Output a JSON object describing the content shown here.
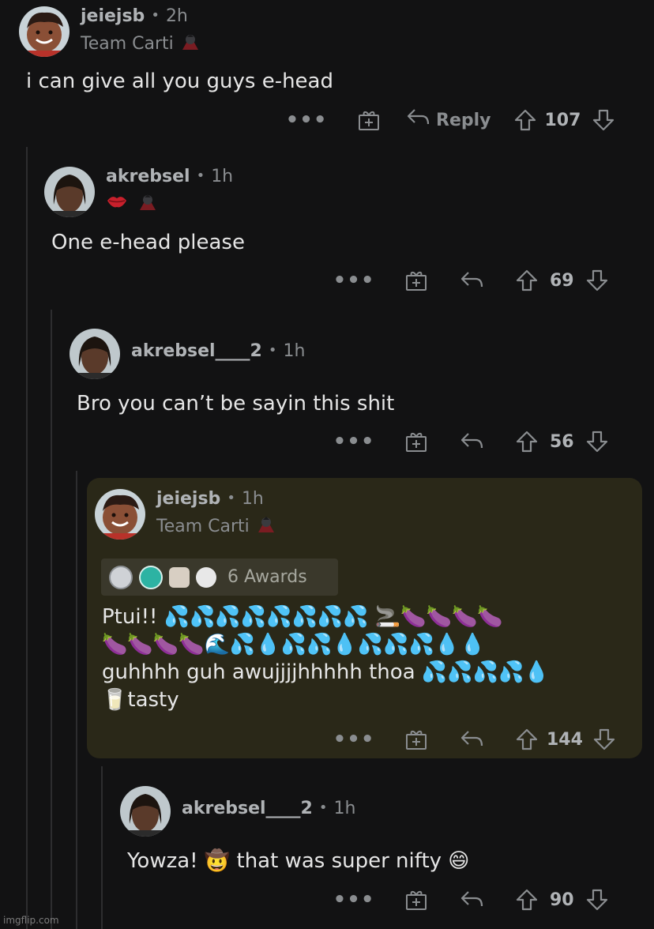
{
  "comments": [
    {
      "username": "jeiejsb",
      "sep": "•",
      "age": "2h",
      "flair": "Team Carti",
      "body": "i can give all you guys e-head",
      "more": "•••",
      "reply": "Reply",
      "score": "107"
    },
    {
      "username": "akrebsel",
      "sep": "•",
      "age": "1h",
      "body": "One e-head please",
      "more": "•••",
      "score": "69"
    },
    {
      "username": "akrebsel____2",
      "sep": "•",
      "age": "1h",
      "body": "Bro you can’t be sayin this shit",
      "more": "•••",
      "score": "56"
    },
    {
      "username": "jeiejsb",
      "sep": "•",
      "age": "1h",
      "flair": "Team Carti",
      "awards_label": "6 Awards",
      "body_line1": "Ptui!! 💦💦💦💦💦💦💦💦 🚬🍆🍆🍆🍆",
      "body_line2": "🍆🍆🍆🍆🌊💦💧💦💦💧💦💦💦💧💧",
      "body_line3": "guhhhh guh awujjjjhhhhh thoa 💦💦💦💦💧",
      "body_line4": "🥛tasty",
      "more": "•••",
      "score": "144"
    },
    {
      "username": "akrebsel____2",
      "sep": "•",
      "age": "1h",
      "body": "Yowza! 🤠 that was super nifty 😄",
      "more": "•••",
      "score": "90"
    }
  ],
  "watermark": "imgflip.com",
  "colors": {
    "background": "#121213",
    "highlight": "#2a2818",
    "muted": "#8a8d90"
  }
}
